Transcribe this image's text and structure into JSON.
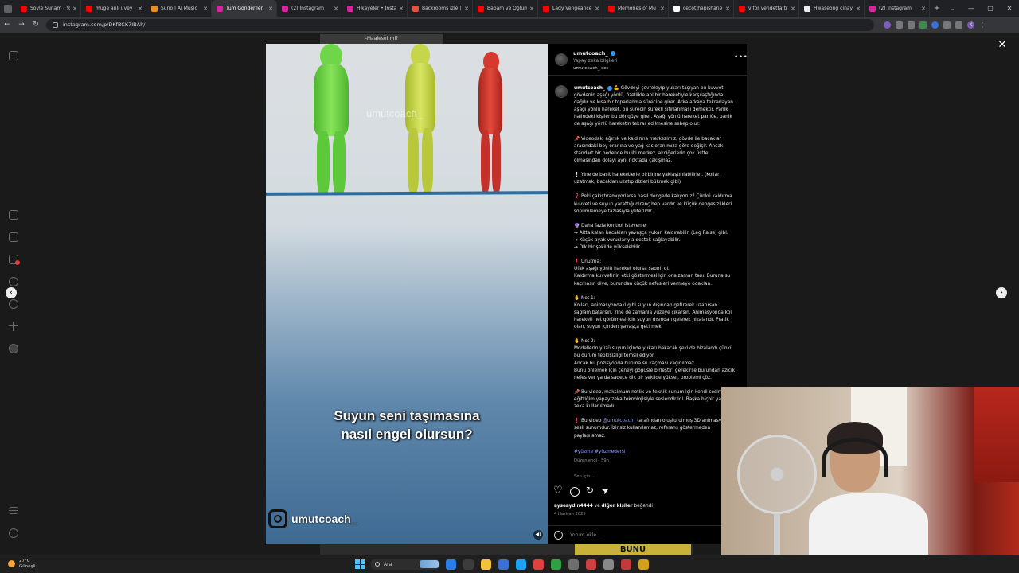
{
  "browser": {
    "tabs": [
      {
        "label": "Söyle Sunam - Yo",
        "fav": "#ff0000",
        "active": false
      },
      {
        "label": "müge anlı üvey ",
        "fav": "#ff0000",
        "active": false
      },
      {
        "label": "Suno | AI Music",
        "fav": "#f08a24",
        "active": false
      },
      {
        "label": "Tüm Gönderiler ",
        "fav": "#d6249f",
        "active": true
      },
      {
        "label": "(2) Instagram",
        "fav": "#d6249f",
        "active": false
      },
      {
        "label": "Hikayeler • Insta",
        "fav": "#d6249f",
        "active": false
      },
      {
        "label": "Backrooms izle |",
        "fav": "#e2553a",
        "active": false
      },
      {
        "label": "Babam ve Oğlum",
        "fav": "#ff0000",
        "active": false
      },
      {
        "label": "Lady Vengeance",
        "fav": "#ff0000",
        "active": false
      },
      {
        "label": "Memories of Mu",
        "fav": "#ff0000",
        "active": false
      },
      {
        "label": "cecot hapishane",
        "fav": "#ffffff",
        "active": false
      },
      {
        "label": "v for vendetta tr",
        "fav": "#ff0000",
        "active": false
      },
      {
        "label": "Hwaseong cinaye",
        "fav": "#eeeeee",
        "active": false
      },
      {
        "label": "(2) Instagram",
        "fav": "#d6249f",
        "active": false
      }
    ],
    "url": "instagram.com/p/DKfBCK7IBAh/",
    "profile_initial": "K"
  },
  "video": {
    "top_label": "-Maalesef mi?",
    "watermark": "umutcoach_",
    "caption_line1": "Suyun seni taşımasına",
    "caption_line2": "nasıl engel olursun?",
    "brand": "umutcoach_",
    "bottom_label": "BUNU"
  },
  "post": {
    "username": "umutcoach_",
    "ai_label": "Yapay zeka bilgileri",
    "audio": "umutcoach_ ses",
    "caption_username": "umutcoach_",
    "caption_body": "💪 Gövdeyi çevreleyip yukarı taşıyan bu kuvvet, gövdenin aşağı yönlü, özellikle ani bir hareketiyle karşılaştığında dağılır ve kısa bir toparlanma sürecine girer. Arka arkaya tekrarlayan aşağı yönlü hareket, bu sürecin sürekli sıfırlanması demektir. Panik halindeki kişiler bu döngüye girer. Aşağı yönlü hareket paniğe, panik de aşağı yönlü hareketin tekrar edilmesine sebep olur.\n\n📌 Videodaki ağırlık ve kaldırma merkezimiz, gövde ile bacaklar arasındaki boy oranına ve yağ-kas oranımıza göre değişir. Ancak standart bir bedende bu iki merkez, akciğerlerin çok üstte olmasından dolayı aynı noktada çakışmaz.\n\n❕ Yine de basit hareketlerle birbirine yaklaştırılabilirler. (Kolları uzatmak, bacakları uzatıp dizleri bükmek gibi)\n\n❓ Peki çakıştıramıyorlarsa nasıl dengede kalıyoruz? Çünkü kaldırma kuvveti ve suyun yarattığı direnç hep vardır ve küçük dengesizlikleri sönümlemeye fazlasıyla yeterlidir.\n\n🔮 Daha fazla kontrol isteyenler\n→ Altta kalan bacakları yavaşça yukarı kaldırabilir. (Leg Raise) gibi.\n→ Küçük ayak vuruşlarıyla destek sağlayabilir.\n→ Dik bir şekilde yükselebilir.\n\n❗ Unutma:\nUfak aşağı yönlü hareket olursa sabırlı ol.\nKaldırma kuvvetinin etki göstermesi için ona zaman tanı. Buruna su kaçmasın diye, burundan küçük nefesleri vermeye odaklan.\n\n✋ Not 1:\nKolları, animasyondaki gibi suyun dışından getirerek uzatırsan sağlam batarsın. Yine de zamanla yüzeye çıkarsın. Animasyonda kol hareketi net görülmesi için suyun dışından gelerek hizalandı. Pratik olan, suyun içinden yavaşça getirmek.\n\n✋ Not 2:\nModellerin yüzü suyun içinde yukarı bakacak şekilde hizalandı çünkü bu durum tepkisizliği temsil ediyor.\nAncak bu pozisyonda buruna su kaçması kaçınılmaz.\nBunu önlemek için çeneyi göğüsle birleştir, gerekirse burundan azıcık nefes ver ya da sadece dik bir şekilde yüksel, problemi çöz.\n\n📌 Bu video, maksimum netlik ve teknik sunum için kendi sesimle eğittiğim yapay zeka teknolojisiyle seslendirildi. Başka hiçbir yapay zeka kullanılmadı.\n\n❗ Bu video ",
    "caption_mention": "@umutcoach_",
    "caption_tail": " tarafından oluşturulmuş 3D animasyon ve sesli sunumdur. İzinsiz kullanılamaz, referans göstermeden paylaşılamaz.",
    "hashtags": "#yüzme #yüzmedersi",
    "edited": "Düzenlendi · 59h",
    "translate": "Sen için ⌄",
    "liked_by_user": "ayseaydin4444",
    "liked_by_mid": " ve ",
    "liked_by_rest": "diğer kişiler",
    "liked_by_tail": " beğendi",
    "date": "4 Haziran 2025",
    "comment_placeholder": "Yorum ekle..."
  },
  "taskbar": {
    "temp": "27°C",
    "weather": "Güneşli",
    "search": "Ara",
    "apps": [
      "#2b7de9",
      "#3c3c3c",
      "#f2c23a",
      "#3c6fd6",
      "#1da1f2",
      "#e2403f",
      "#2ea043",
      "#6e6e6e",
      "#d14040",
      "#888888",
      "#c23b3b",
      "#d4a017"
    ]
  }
}
